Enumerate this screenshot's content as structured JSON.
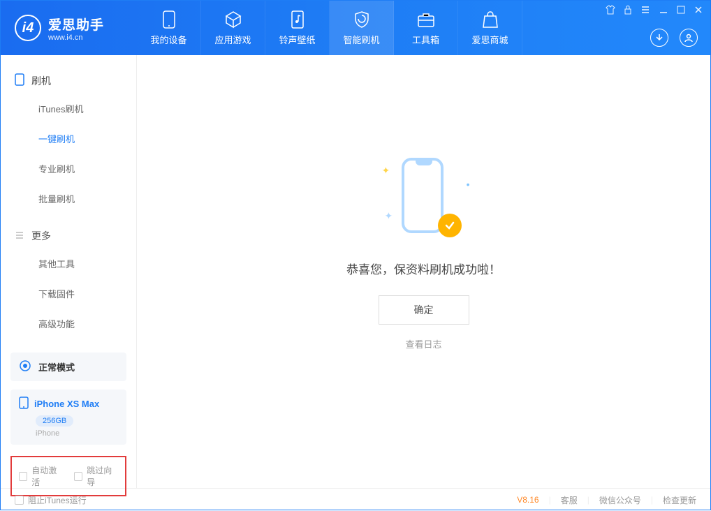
{
  "app": {
    "title": "爱思助手",
    "subtitle": "www.i4.cn"
  },
  "nav": {
    "tabs": [
      {
        "label": "我的设备"
      },
      {
        "label": "应用游戏"
      },
      {
        "label": "铃声壁纸"
      },
      {
        "label": "智能刷机"
      },
      {
        "label": "工具箱"
      },
      {
        "label": "爱思商城"
      }
    ]
  },
  "sidebar": {
    "section1": {
      "title": "刷机",
      "items": [
        "iTunes刷机",
        "一键刷机",
        "专业刷机",
        "批量刷机"
      ]
    },
    "section2": {
      "title": "更多",
      "items": [
        "其他工具",
        "下载固件",
        "高级功能"
      ]
    },
    "mode": "正常模式",
    "device": {
      "name": "iPhone XS Max",
      "capacity": "256GB",
      "type": "iPhone"
    },
    "checks": {
      "c1": "自动激活",
      "c2": "跳过向导"
    }
  },
  "main": {
    "message": "恭喜您，保资料刷机成功啦！",
    "ok": "确定",
    "log": "查看日志"
  },
  "footer": {
    "blockitunes": "阻止iTunes运行",
    "version": "V8.16",
    "links": [
      "客服",
      "微信公众号",
      "检查更新"
    ]
  }
}
